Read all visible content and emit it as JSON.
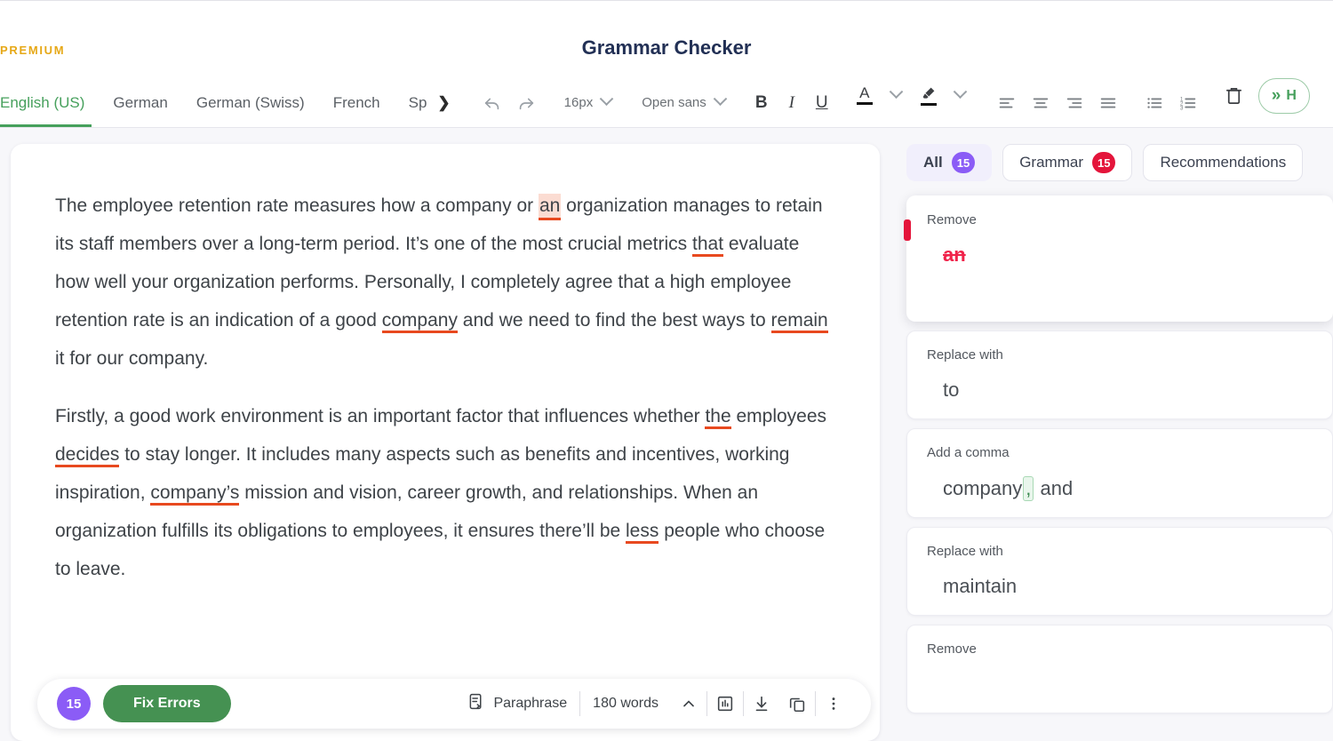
{
  "header": {
    "premium_label": "PREMIUM",
    "title": "Grammar Checker"
  },
  "toolbar": {
    "languages": [
      {
        "label": "English (US)",
        "active": true
      },
      {
        "label": "German",
        "active": false
      },
      {
        "label": "German (Swiss)",
        "active": false
      },
      {
        "label": "French",
        "active": false
      },
      {
        "label": "Sp",
        "active": false
      }
    ],
    "more_languages_icon": "chevron-right-icon",
    "undo_icon": "undo-icon",
    "redo_icon": "redo-icon",
    "font_size": "16px",
    "font_family": "Open sans",
    "bold_label": "B",
    "italic_label": "I",
    "underline_label": "U",
    "text_color_label": "A",
    "highlight_icon": "highlighter-icon",
    "align_left_icon": "align-left-icon",
    "align_center_icon": "align-center-icon",
    "align_right_icon": "align-right-icon",
    "align_justify_icon": "align-justify-icon",
    "bullet_list_icon": "bullet-list-icon",
    "numbered_list_icon": "numbered-list-icon",
    "delete_icon": "trash-icon",
    "hide_button_label": "H",
    "hide_button_chevrons": "»"
  },
  "document": {
    "paragraph1": {
      "seg1": "The employee retention rate measures how a company or ",
      "error_an": "an",
      "seg2": " organization manages to retain its staff members over a long-term period. It’s one of the most crucial metrics ",
      "error_that": "that",
      "seg3": " evaluate how well your organization performs. Personally, I completely agree that a high employee retention rate is an indication of a good ",
      "error_company": "company",
      "seg4": " and we need to find the best ways to ",
      "error_remain": "remain",
      "seg5": " it for our company."
    },
    "paragraph2": {
      "seg1": "Firstly, a good work environment is an important factor that influences whether ",
      "error_the": "the",
      "seg2": " employees ",
      "error_decides": "decides",
      "seg3": " to stay longer. It includes many aspects such as benefits and incentives, working inspiration, ",
      "error_companys": "company’s",
      "seg4": " mission and vision, career growth, and relationships. When an organization fulfills its obligations to employees, it ensures there’ll be ",
      "error_less": "less",
      "seg5": " people who choose to leave."
    }
  },
  "bottom_bar": {
    "error_count": "15",
    "fix_errors_label": "Fix Errors",
    "paraphrase_label": "Paraphrase",
    "paraphrase_icon": "paraphrase-icon",
    "word_count": "180 words",
    "collapse_icon": "chevron-up-icon",
    "stats_icon": "bar-chart-icon",
    "download_icon": "download-icon",
    "copy_icon": "copy-icon",
    "more_icon": "three-dots-vertical-icon"
  },
  "sidebar": {
    "tabs": [
      {
        "label": "All",
        "count": "15",
        "badge_color": "purple",
        "active": true
      },
      {
        "label": "Grammar",
        "count": "15",
        "badge_color": "red",
        "active": false
      },
      {
        "label": "Recommendations",
        "count": "",
        "badge_color": "",
        "active": false
      }
    ],
    "suggestions": [
      {
        "label": "Remove",
        "value": "an",
        "kind": "remove"
      },
      {
        "label": "Replace with",
        "value": "to",
        "kind": "replace"
      },
      {
        "label": "Add a comma",
        "value_before": "company",
        "comma": ",",
        "value_after": "and",
        "kind": "comma"
      },
      {
        "label": "Replace with",
        "value": "maintain",
        "kind": "replace"
      },
      {
        "label": "Remove",
        "value": "",
        "kind": "remove"
      }
    ]
  },
  "colors": {
    "accent_green": "#459152",
    "badge_purple": "#8b5cf6",
    "badge_red": "#e4153b",
    "error_underline": "#e8491f",
    "premium_gold": "#e6a817"
  }
}
